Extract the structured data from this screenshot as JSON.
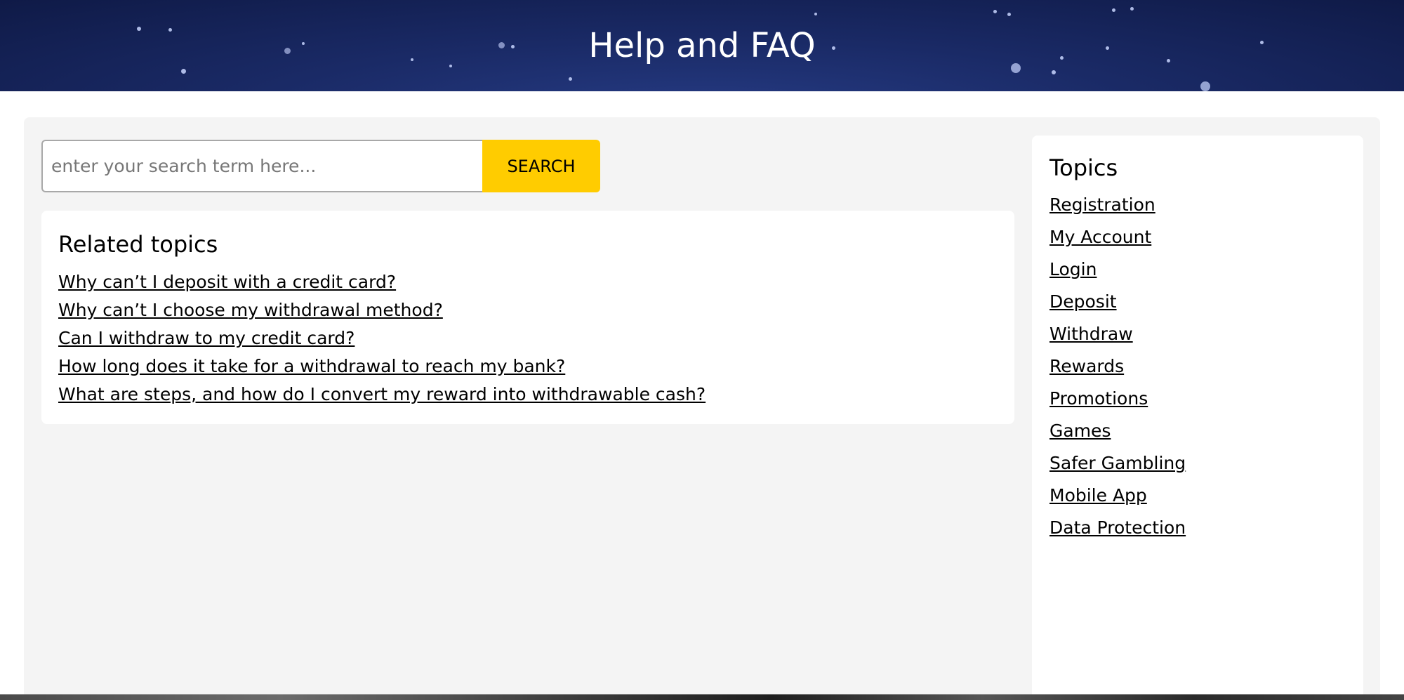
{
  "header": {
    "title": "Help and FAQ"
  },
  "search": {
    "placeholder": "enter your search term here...",
    "button_label": "SEARCH"
  },
  "related": {
    "heading": "Related topics",
    "items": [
      "Why can’t I deposit with a credit card?",
      "Why can’t I choose my withdrawal method?",
      "Can I withdraw to my credit card?",
      "How long does it take for a withdrawal to reach my bank?",
      "What are steps, and how do I convert my reward into withdrawable cash?"
    ]
  },
  "topics": {
    "heading": "Topics",
    "items": [
      "Registration",
      "My Account",
      "Login",
      "Deposit",
      "Withdraw",
      "Rewards",
      "Promotions",
      "Games",
      "Safer Gambling",
      "Mobile App",
      "Data Protection"
    ]
  },
  "colors": {
    "header_bg": "#1a2a66",
    "accent": "#ffcc00",
    "panel_bg": "#f4f4f4"
  }
}
